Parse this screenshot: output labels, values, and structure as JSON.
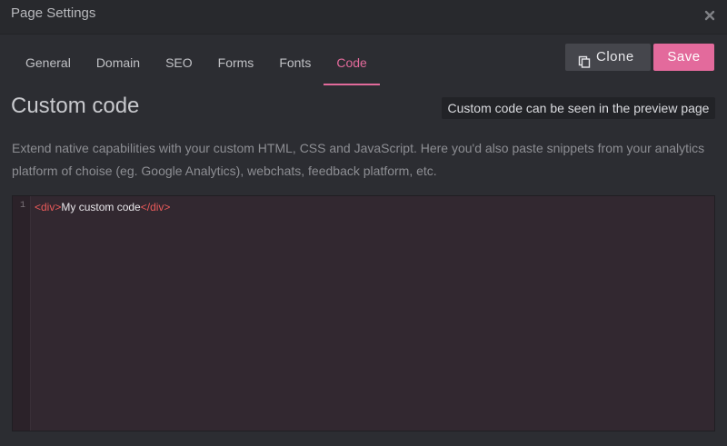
{
  "window": {
    "title": "Page Settings",
    "close_icon": "close-icon"
  },
  "tabs": [
    {
      "label": "General",
      "active": false
    },
    {
      "label": "Domain",
      "active": false
    },
    {
      "label": "SEO",
      "active": false
    },
    {
      "label": "Forms",
      "active": false
    },
    {
      "label": "Fonts",
      "active": false
    },
    {
      "label": "Code",
      "active": true
    }
  ],
  "toolbar": {
    "clone_label": "Clone",
    "clone_icon": "copy-icon",
    "save_label": "Save"
  },
  "content": {
    "heading": "Custom code",
    "hint": "Custom code can be seen in the preview page",
    "description": "Extend native capabilities with your custom HTML, CSS and JavaScript. Here you'd also paste snippets from your analytics platform of choise (eg. Google Analytics), webchats, feedback platform, etc."
  },
  "editor": {
    "line_number": "1",
    "open_tag": "<div>",
    "text": "My custom code",
    "close_tag": "</div>"
  },
  "colors": {
    "accent": "#e36a9c",
    "background": "#2c2d32",
    "editor_background": "#322830",
    "tag": "#ea5a5a"
  }
}
